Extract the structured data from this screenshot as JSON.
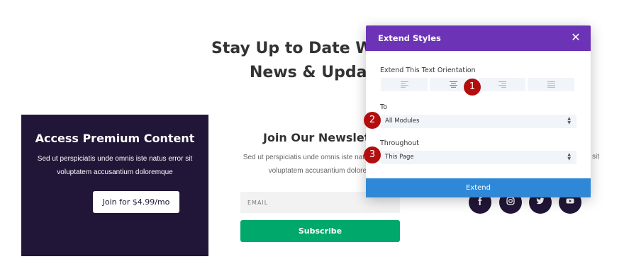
{
  "hero": {
    "title_line1": "Stay Up to Date With T",
    "title_line2": "News & Updat"
  },
  "premium": {
    "title": "Access Premium Content",
    "text": "Sed ut perspiciatis unde omnis iste natus error sit voluptatem accusantium doloremque",
    "button_label": "Join for $4.99/mo"
  },
  "newsletter": {
    "title": "Join Our Newslett",
    "text": "Sed ut perspiciatis unde omnis iste natus error sit voluptatem accusantium dolorem",
    "email_placeholder": "EMAIL",
    "subscribe_label": "Subscribe"
  },
  "right_peek_text": "sit",
  "social": [
    "facebook-icon",
    "instagram-icon",
    "twitter-icon",
    "youtube-icon"
  ],
  "modal": {
    "title": "Extend Styles",
    "close_label": "✕",
    "orientation_label": "Extend This Text Orientation",
    "orientation_options": [
      "left",
      "center",
      "right",
      "justify"
    ],
    "orientation_selected": "center",
    "to_label": "To",
    "to_value": "All Modules",
    "throughout_label": "Throughout",
    "throughout_value": "This Page",
    "extend_label": "Extend"
  },
  "steps": [
    "1",
    "2",
    "3"
  ],
  "colors": {
    "modal_header": "#6c33b7",
    "extend_button": "#2e88d7",
    "premium_bg": "#221638",
    "subscribe_button": "#00a86b",
    "step_badge": "#b30d0d"
  }
}
